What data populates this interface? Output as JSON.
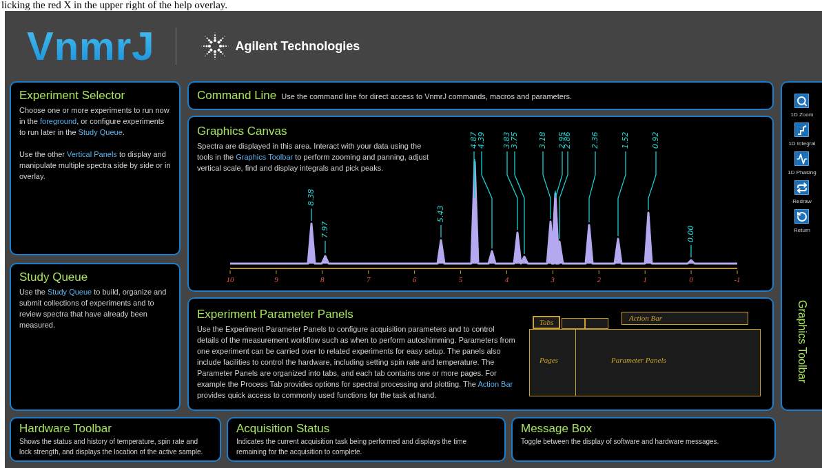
{
  "top_caption": "licking the red X in the upper right of the help overlay.",
  "header": {
    "product": "VnmrJ",
    "company": "Agilent Technologies"
  },
  "experiment_selector": {
    "title": "Experiment Selector",
    "paragraphs": [
      [
        {
          "t": "Choose one or more experiments to run now in the ",
          "link": false
        },
        {
          "t": "foreground",
          "link": true
        },
        {
          "t": ", or configure experiments to run later in the ",
          "link": false
        },
        {
          "t": "Study Queue",
          "link": true
        },
        {
          "t": ".",
          "link": false
        }
      ],
      [
        {
          "t": "Use the other ",
          "link": false
        },
        {
          "t": "Vertical Panels",
          "link": true
        },
        {
          "t": " to display and manipulate multiple spectra side by side or in overlay.",
          "link": false
        }
      ]
    ]
  },
  "study_queue": {
    "title": "Study Queue",
    "paragraphs": [
      [
        {
          "t": "Use the ",
          "link": false
        },
        {
          "t": "Study Queue",
          "link": true
        },
        {
          "t": " to build, organize and submit collections of experiments and to review spectra that have already been measured.",
          "link": false
        }
      ]
    ]
  },
  "command_line": {
    "title": "Command Line",
    "description": "Use the command line for direct access to VnmrJ commands, macros and parameters."
  },
  "graphics_canvas": {
    "title": "Graphics Canvas",
    "paragraphs": [
      [
        {
          "t": "Spectra are displayed in this area. Interact with your data using the tools in the ",
          "link": false
        },
        {
          "t": "Graphics Toolbar",
          "link": true
        },
        {
          "t": " to perform zooming and panning, adjust vertical scale, find and display integrals and pick peaks.",
          "link": false
        }
      ]
    ],
    "peak_labels": [
      "8.38",
      "7.97",
      "5.43",
      "4.87",
      "4.39",
      "3.83",
      "3.75",
      "3.18",
      "2.95",
      "2.86",
      "2.36",
      "1.52",
      "0.92",
      "0.00"
    ],
    "axis_ticks": [
      "10",
      "9",
      "8",
      "7",
      "6",
      "5",
      "4",
      "3",
      "2",
      "1",
      "0",
      "-1"
    ]
  },
  "parameter_panels": {
    "title": "Experiment Parameter Panels",
    "paragraphs": [
      [
        {
          "t": "Use the Experiment Parameter Panels to configure acquisition parameters and to control details of the measurement workflow such as when to perform autoshimming. Parameters from one experiment can be carried over to related experiments for easy setup. The panels also include facilities to control the hardware, including setting spin rate and temperature. The Parameter Panels are organized into tabs, and each tab contains one or more pages. For example the Process Tab provides options for spectral processing and plotting. The ",
          "link": false
        },
        {
          "t": "Action Bar",
          "link": true
        },
        {
          "t": " provides quick access to commonly used functions for the task at hand.",
          "link": false
        }
      ]
    ],
    "diagram": {
      "tabs": "Tabs",
      "action_bar": "Action Bar",
      "pages": "Pages",
      "panels": "Parameter Panels"
    }
  },
  "graphics_toolbar": {
    "title": "Graphics Toolbar",
    "tools": [
      {
        "kind": "zoom",
        "label": "1D Zoom"
      },
      {
        "kind": "integral",
        "label": "1D Integral"
      },
      {
        "kind": "phasing",
        "label": "1D Phasing"
      },
      {
        "kind": "redraw",
        "label": "Redraw"
      },
      {
        "kind": "return",
        "label": "Return"
      }
    ]
  },
  "bottom_panels": [
    {
      "title": "Hardware Toolbar",
      "description": "Shows the status and history of temperature, spin rate and lock strength, and displays the location of the active sample."
    },
    {
      "title": "Acquisition Status",
      "description": "Indicates the current acquisition task being performed and displays the time remaining for the acquisition to complete."
    },
    {
      "title": "Message Box",
      "description": "Toggle between the display of software and hardware messages."
    }
  ]
}
